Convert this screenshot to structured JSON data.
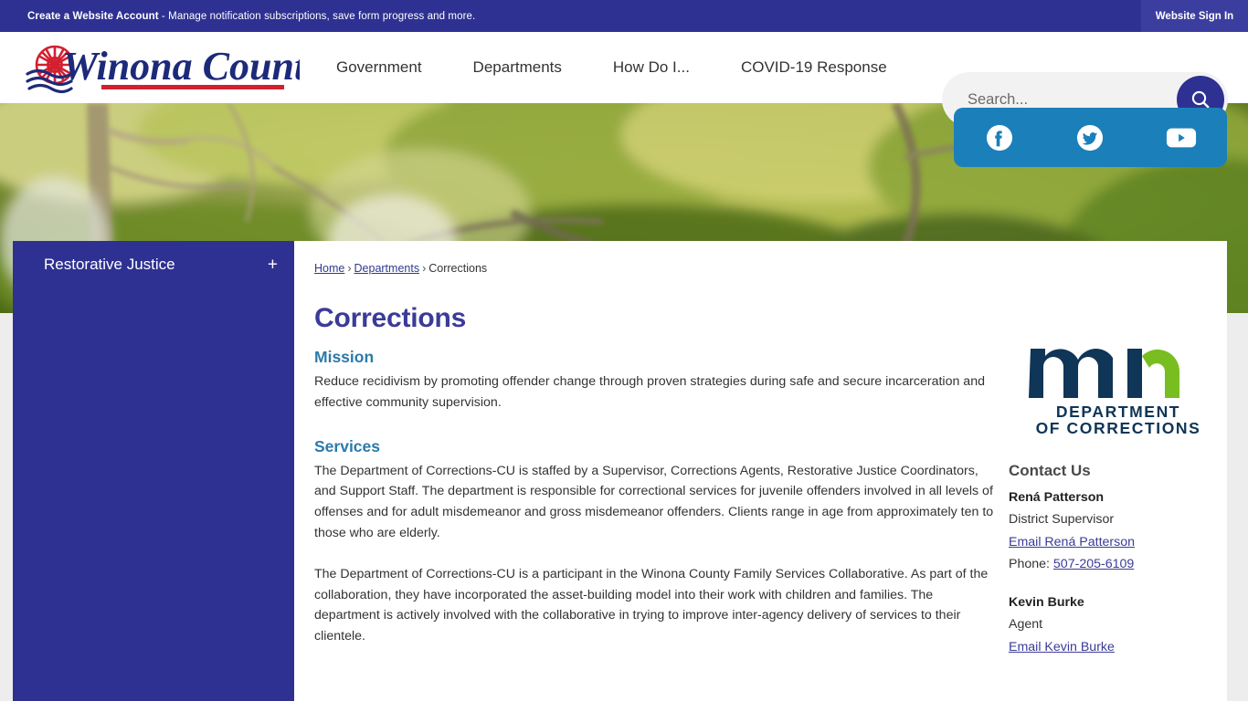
{
  "topbar": {
    "announcement_bold": "Create a Website Account",
    "announcement_rest": " - Manage notification subscriptions, save form progress and more.",
    "signin_label": "Website Sign In"
  },
  "header": {
    "logo_text": "Winona County",
    "nav": [
      {
        "label": "Government"
      },
      {
        "label": "Departments"
      },
      {
        "label": "How Do I..."
      },
      {
        "label": "COVID-19 Response"
      }
    ],
    "search": {
      "placeholder": "Search...",
      "value": "",
      "button_icon": "search-icon"
    }
  },
  "social": {
    "items": [
      {
        "name": "facebook-icon",
        "label": "Facebook"
      },
      {
        "name": "twitter-icon",
        "label": "Twitter"
      },
      {
        "name": "youtube-icon",
        "label": "YouTube"
      }
    ],
    "background": "#1b7fba"
  },
  "sidebar": {
    "background": "#2e3192",
    "items": [
      {
        "label": "Restorative Justice",
        "expander": "+"
      }
    ]
  },
  "breadcrumb": {
    "home": "Home",
    "departments": "Departments",
    "current": "Corrections",
    "separator": "›"
  },
  "main": {
    "title": "Corrections",
    "sections": [
      {
        "heading": "Mission",
        "paragraphs": [
          "Reduce recidivism by promoting offender change through proven strategies during safe and secure incarceration and effective community supervision."
        ]
      },
      {
        "heading": "Services",
        "paragraphs": [
          "The Department of Corrections-CU is staffed by a Supervisor, Corrections Agents, Restorative Justice Coordinators, and Support Staff. The department is responsible for correctional services for juvenile offenders involved in all levels of offenses and for adult misdemeanor and gross misdemeanor offenders. Clients range in age from approximately ten to those who are elderly.",
          "The Department of Corrections-CU is a participant in the Winona County Family Services Collaborative. As part of the collaboration, they have incorporated the asset-building model into their work with children and families. The department is actively involved with the collaborative in trying to improve inter-agency delivery of services to their clientele."
        ]
      }
    ]
  },
  "rail": {
    "logo": {
      "name": "mn-department-of-corrections-logo",
      "line1": "DEPARTMENT",
      "line2": "OF CORRECTIONS",
      "navy": "#0f3557",
      "green": "#78be20"
    },
    "contact_heading": "Contact Us",
    "contacts": [
      {
        "name": "Rená Patterson",
        "role": "District Supervisor",
        "email_link": "Email Rená Patterson",
        "phone_label": "Phone: ",
        "phone": "507-205-6109"
      },
      {
        "name": "Kevin Burke",
        "role": "Agent",
        "email_link": "Email Kevin Burke",
        "phone_label": "",
        "phone": ""
      }
    ]
  },
  "colors": {
    "brand_navy": "#2e3192",
    "accent_blue": "#2c7aa8",
    "link_blue": "#3b3b98",
    "social_blue": "#1b7fba",
    "page_bg": "#ededed"
  }
}
